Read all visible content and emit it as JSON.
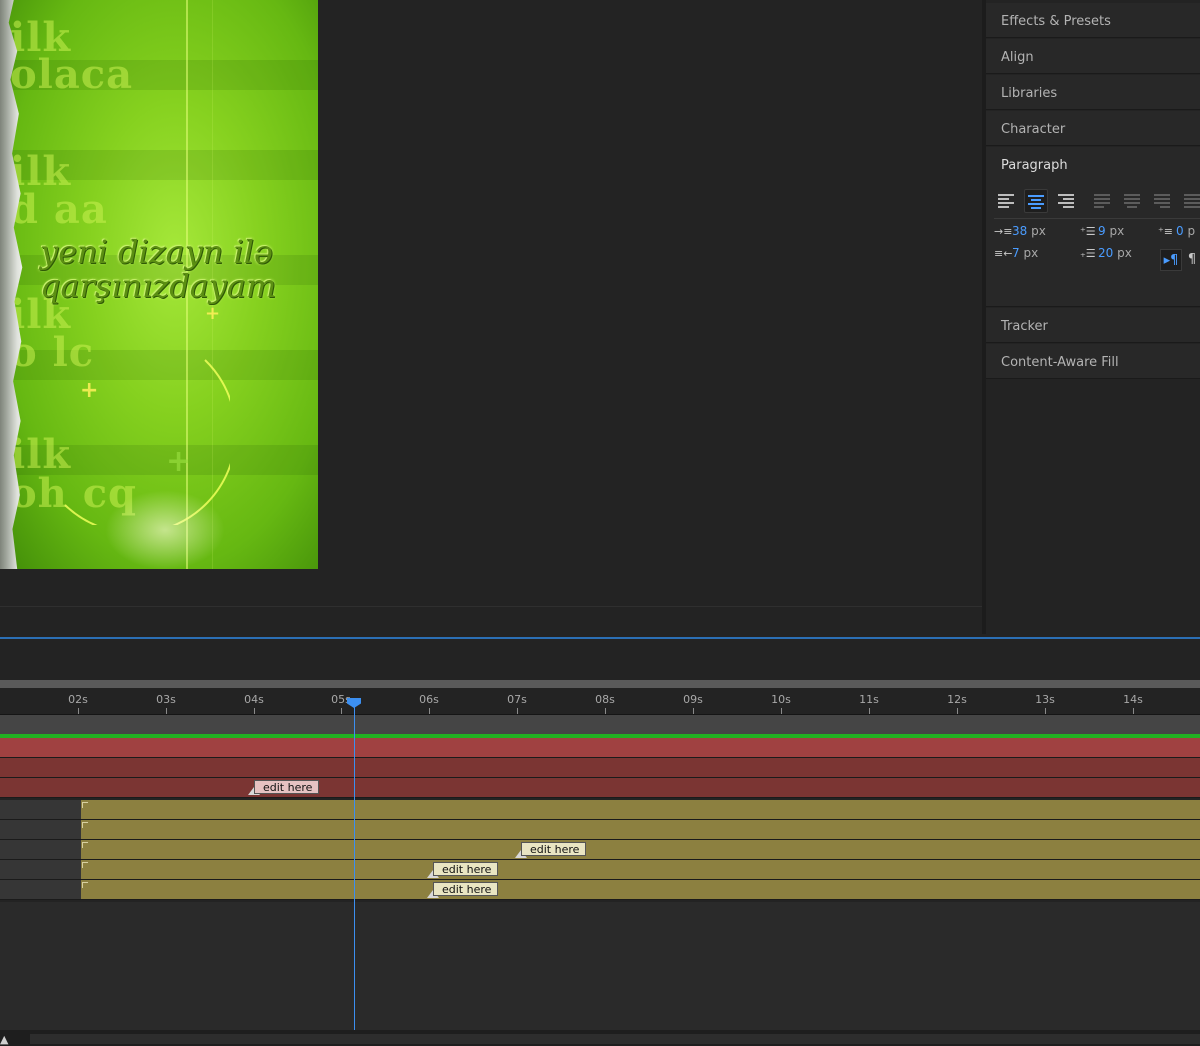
{
  "comp": {
    "title_line1": "yeni dizayn ilə",
    "title_line2": "qarşınızdayam",
    "ghost_lines": [
      "ilk",
      "olaca",
      "ilk",
      "d aa",
      "ilk",
      "o lc",
      "ilk",
      "oh cq"
    ]
  },
  "panels": {
    "items": [
      {
        "label": "Effects & Presets"
      },
      {
        "label": "Align"
      },
      {
        "label": "Libraries"
      },
      {
        "label": "Character"
      },
      {
        "label": "Paragraph"
      },
      {
        "label": "Tracker"
      },
      {
        "label": "Content-Aware Fill"
      }
    ],
    "paragraph": {
      "indent_left": {
        "value": "38",
        "unit": "px"
      },
      "space_before": {
        "value": "9",
        "unit": "px"
      },
      "indent_first": {
        "value": "0",
        "unit": "p"
      },
      "indent_right": {
        "value": "7",
        "unit": "px"
      },
      "space_after": {
        "value": "20",
        "unit": "px"
      },
      "ltr_glyph": "▸¶",
      "rtl_glyph": "¶"
    }
  },
  "timeline": {
    "ruler_labels": [
      "02s",
      "03s",
      "04s",
      "05s",
      "06s",
      "07s",
      "08s",
      "09s",
      "10s",
      "11s",
      "12s",
      "13s",
      "14s"
    ],
    "playhead_time": "05s",
    "markers": [
      {
        "label": "edit here",
        "track": 3
      },
      {
        "label": "edit here",
        "track": 6
      },
      {
        "label": "edit here",
        "track": 7
      },
      {
        "label": "edit here",
        "track": 8
      }
    ]
  },
  "colors": {
    "accent": "#3c8ff0",
    "layer_red": "#7b3533",
    "layer_gold": "#8c8040",
    "work_area_green": "#22b022"
  }
}
